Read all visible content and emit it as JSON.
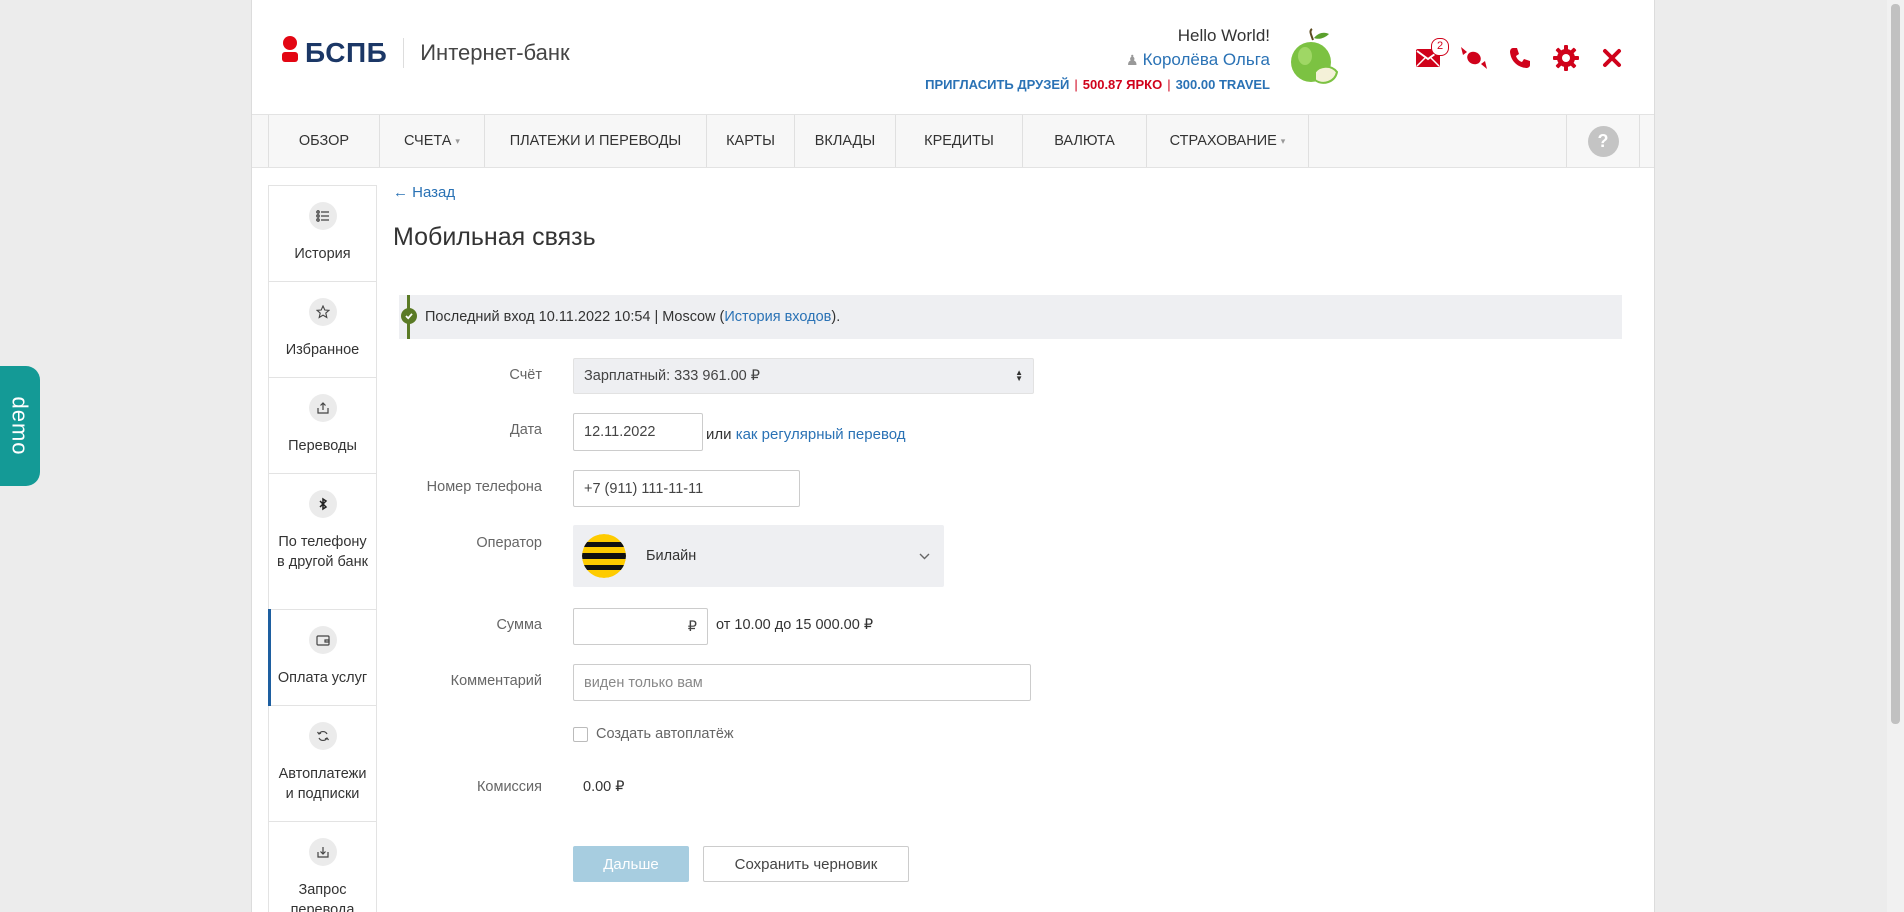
{
  "brand": {
    "logo_text": "БСПБ",
    "app_title": "Интернет-банк"
  },
  "user": {
    "greeting": "Hello World!",
    "name": "Королёва Ольга",
    "invite": "ПРИГЛАСИТЬ ДРУЗЕЙ",
    "points_yarko": "500.87 ЯРКО",
    "points_travel": "300.00 TRAVEL"
  },
  "header_icons": {
    "mail_badge": "2"
  },
  "nav": {
    "items": [
      {
        "label": "ОБЗОР"
      },
      {
        "label": "СЧЕТА"
      },
      {
        "label": "ПЛАТЕЖИ И ПЕРЕВОДЫ"
      },
      {
        "label": "КАРТЫ"
      },
      {
        "label": "ВКЛАДЫ"
      },
      {
        "label": "КРЕДИТЫ"
      },
      {
        "label": "ВАЛЮТА"
      },
      {
        "label": "СТРАХОВАНИЕ"
      }
    ],
    "help": "?"
  },
  "sidebar": {
    "items": [
      {
        "label": "История",
        "icon": "list-icon"
      },
      {
        "label": "Избранное",
        "icon": "star-icon"
      },
      {
        "label": "Переводы",
        "icon": "transfer-icon"
      },
      {
        "label": "По телефону в другой банк",
        "icon": "phone-transfer-icon"
      },
      {
        "label": "Оплата услуг",
        "icon": "wallet-icon"
      },
      {
        "label": "Автоплатежи и подписки",
        "icon": "refresh-icon"
      },
      {
        "label": "Запрос перевода",
        "icon": "request-icon"
      }
    ]
  },
  "main": {
    "back": "← Назад",
    "title": "Мобильная связь",
    "last_login_prefix": "Последний вход 10.11.2022 10:54 | Moscow (",
    "last_login_link": "История входов",
    "last_login_suffix": ")."
  },
  "form": {
    "account_label": "Счёт",
    "account_value": "Зарплатный: 333 961.00 ₽",
    "date_label": "Дата",
    "date_value": "12.11.2022",
    "or_text": "или",
    "regular_link": "как регулярный перевод",
    "phone_label": "Номер телефона",
    "phone_value": "+7 (911) 111-11-11",
    "operator_label": "Оператор",
    "operator_value": "Билайн",
    "sum_label": "Сумма",
    "sum_currency": "₽",
    "sum_hint": "от 10.00 до 15 000.00 ₽",
    "comment_label": "Комментарий",
    "comment_placeholder": "виден только вам",
    "autopay_label": "Создать автоплатёж",
    "commission_label": "Комиссия",
    "commission_value": "0.00 ₽",
    "next_button": "Дальше",
    "draft_button": "Сохранить черновик"
  },
  "demo_tab": "demo",
  "colors": {
    "brand_red": "#e30613",
    "brand_blue": "#1b3766",
    "link": "#2a72b5",
    "teal": "#149a96"
  }
}
